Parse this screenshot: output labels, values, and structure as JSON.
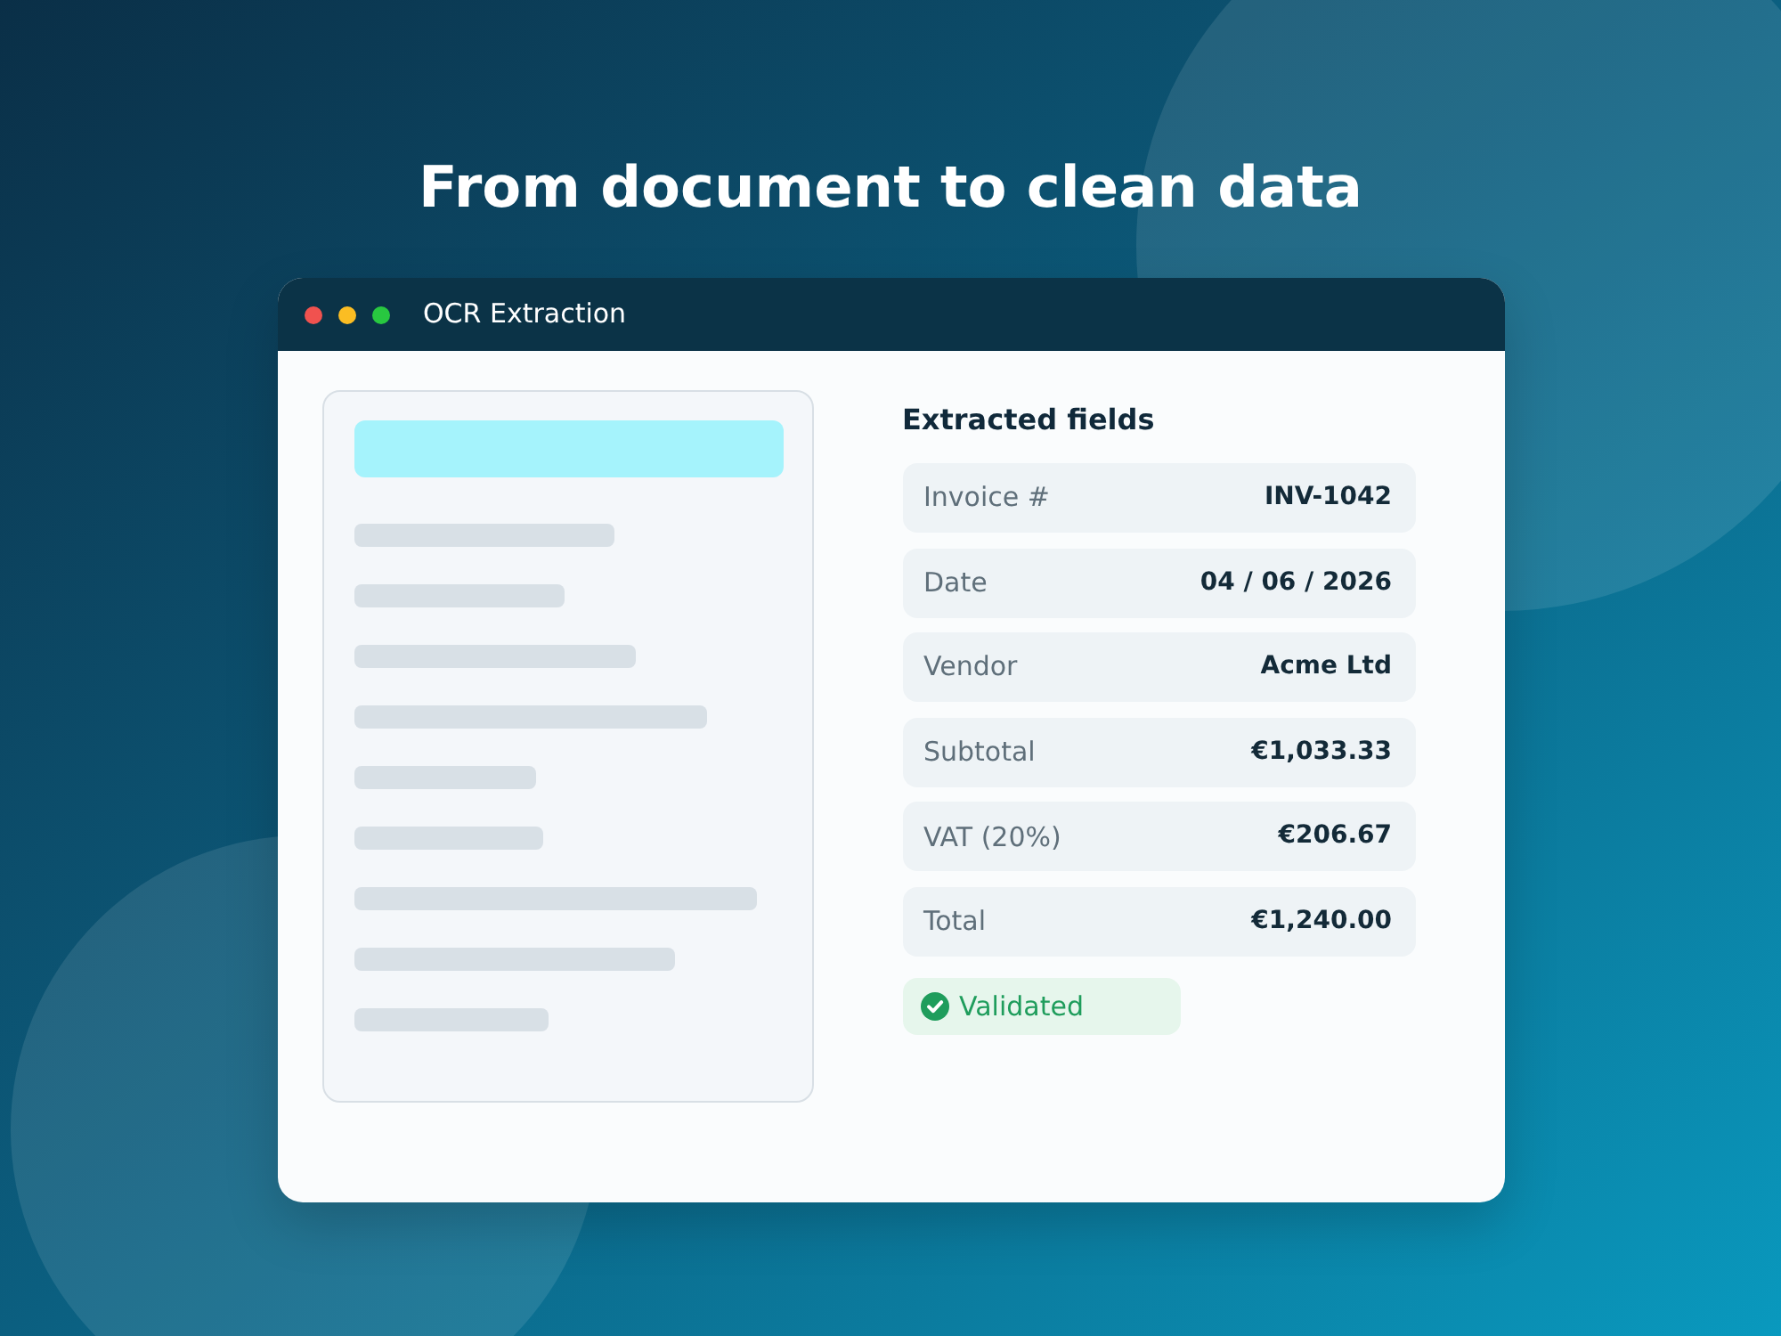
{
  "headline": "From document to clean data",
  "window": {
    "title": "OCR Extraction",
    "controls": [
      {
        "color": "#f0524f"
      },
      {
        "color": "#fbbd23"
      },
      {
        "color": "#28c840"
      }
    ]
  },
  "extracted": {
    "title": "Extracted fields",
    "fields": [
      {
        "label": "Invoice #",
        "value": "INV-1042"
      },
      {
        "label": "Date",
        "value": "04 / 06 / 2026"
      },
      {
        "label": "Vendor",
        "value": "Acme Ltd"
      },
      {
        "label": "Subtotal",
        "value": "€1,033.33"
      },
      {
        "label": "VAT (20%)",
        "value": "€206.67"
      },
      {
        "label": "Total",
        "value": "€1,240.00"
      }
    ],
    "status": {
      "label": "Validated"
    }
  }
}
